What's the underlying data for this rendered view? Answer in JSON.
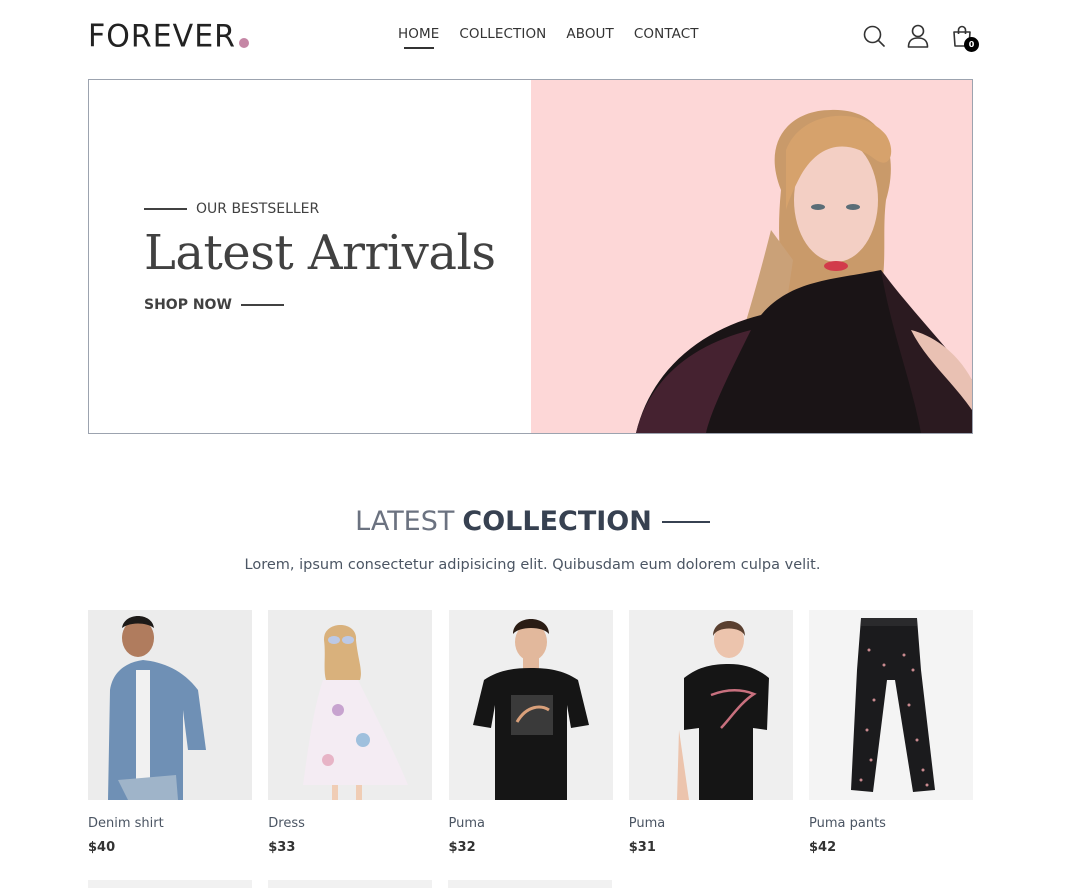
{
  "header": {
    "logo_text": "FOREVER",
    "nav": [
      {
        "label": "HOME",
        "active": true
      },
      {
        "label": "COLLECTION",
        "active": false
      },
      {
        "label": "ABOUT",
        "active": false
      },
      {
        "label": "CONTACT",
        "active": false
      }
    ],
    "cart_count": "0",
    "icons": [
      "search-icon",
      "profile-icon",
      "cart-icon"
    ]
  },
  "hero": {
    "eyebrow": "OUR BESTSELLER",
    "title": "Latest Arrivals",
    "cta": "SHOP NOW",
    "background_color": "#fdd7d7"
  },
  "collection": {
    "title_light": "LATEST",
    "title_bold": "COLLECTION",
    "subtitle": "Lorem, ipsum consectetur adipisicing elit. Quibusdam eum dolorem culpa velit.",
    "products": [
      {
        "name": "Denim shirt",
        "price": "$40"
      },
      {
        "name": "Dress",
        "price": "$33"
      },
      {
        "name": "Puma",
        "price": "$32"
      },
      {
        "name": "Puma",
        "price": "$31"
      },
      {
        "name": "Puma pants",
        "price": "$42"
      }
    ]
  },
  "colors": {
    "accent_dot": "#c586a5",
    "text": "#414141"
  }
}
